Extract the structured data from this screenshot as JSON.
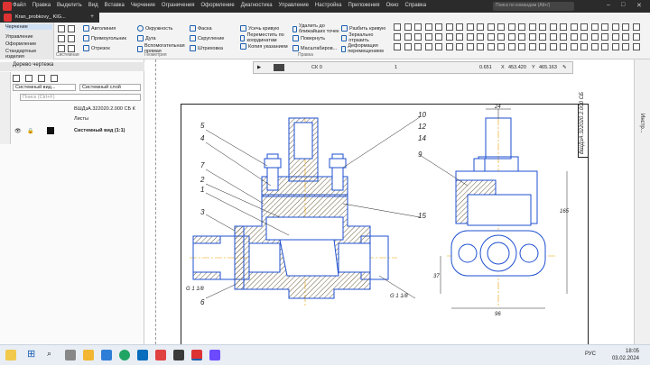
{
  "window": {
    "tab_title": "Kran_probkovy_ KIG...",
    "menu": [
      "Файл",
      "Правка",
      "Выделить",
      "Вид",
      "Вставка",
      "Черчение",
      "Ограничения",
      "Оформление",
      "Диагностика",
      "Управление",
      "Настройка",
      "Приложения",
      "Окно",
      "Справка"
    ],
    "search_placeholder": "Поиск по командам (Alt+/)"
  },
  "ribbon": {
    "categories": [
      "Черчение",
      "Управление",
      "Оформление",
      "Стандартные изделия"
    ],
    "group_labels": [
      "Системная",
      "Геометрия",
      "Правка"
    ],
    "commands_col1": [
      "Автолиния",
      "Прямоугольник",
      "Отрезок"
    ],
    "commands_col2": [
      "Окружность",
      "Дуга",
      "Вспомогательная прямая"
    ],
    "commands_col3": [
      "Фаска",
      "Скругление",
      "Штриховка"
    ],
    "commands_col4": [
      "Усечь кривую",
      "Переместить по координатам",
      "Копия указанием"
    ],
    "commands_col5": [
      "Удалить до ближайших точек",
      "Повернуть",
      "Масштабиров..."
    ],
    "commands_col6": [
      "Разбить кривую",
      "Зеркально отразить",
      "Деформация перемещением"
    ]
  },
  "panel": {
    "title": "Дерево чертежа",
    "view_label": "Системный вид...",
    "layer_label": "Системный слой",
    "filter_placeholder": "Поиск (Ctrl+F)",
    "tree": [
      "ВШДзА.322020.2.000 СБ К",
      "Листы",
      "Системный вид (1:1)"
    ]
  },
  "drawing_toolbar": {
    "sk": "СК 0",
    "step": "0.651",
    "x": "453.420",
    "y": "465.163",
    "layer": "1"
  },
  "drawing": {
    "stamp": "ВШДзА.322020.2.000 СБ",
    "callouts": [
      "5",
      "4",
      "7",
      "2",
      "1",
      "3",
      "6",
      "10",
      "12",
      "14",
      "15",
      "9"
    ],
    "dims": [
      "24",
      "165",
      "96",
      "37",
      "G 1 1/8",
      "G 1 1/8"
    ]
  },
  "right_tab": "Инстр...",
  "taskbar": {
    "lang": "РУС",
    "time": "18:05",
    "date": "03.02.2024"
  },
  "colors": {
    "accent": "#1d5fb0",
    "hatch": "#6b5b3a",
    "part_blue": "#1e4fd0",
    "centerline": "#e8a000"
  }
}
